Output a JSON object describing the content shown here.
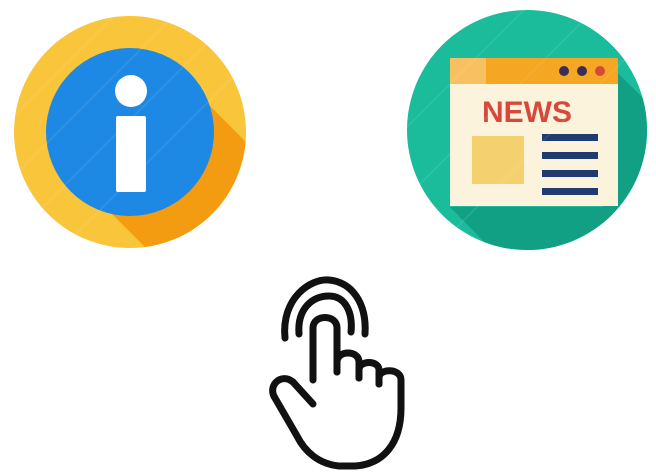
{
  "icons": {
    "info": {
      "icon": "info-icon",
      "colors": {
        "outer": "#f9c53a",
        "outer_shadow": "#f39c12",
        "inner": "#1e88e5",
        "glyph": "#ffffff"
      }
    },
    "news": {
      "icon": "news-browser-icon",
      "label": "NEWS",
      "colors": {
        "outer": "#1abc9c",
        "outer_shadow": "#12a085",
        "window": "#fbf3dc",
        "bar": "#f5a623",
        "text": "#d7483b",
        "block": "#f4d06f",
        "lines": "#1f3b70"
      }
    },
    "tap": {
      "icon": "tap-hand-icon",
      "colors": {
        "stroke": "#111111"
      }
    }
  }
}
